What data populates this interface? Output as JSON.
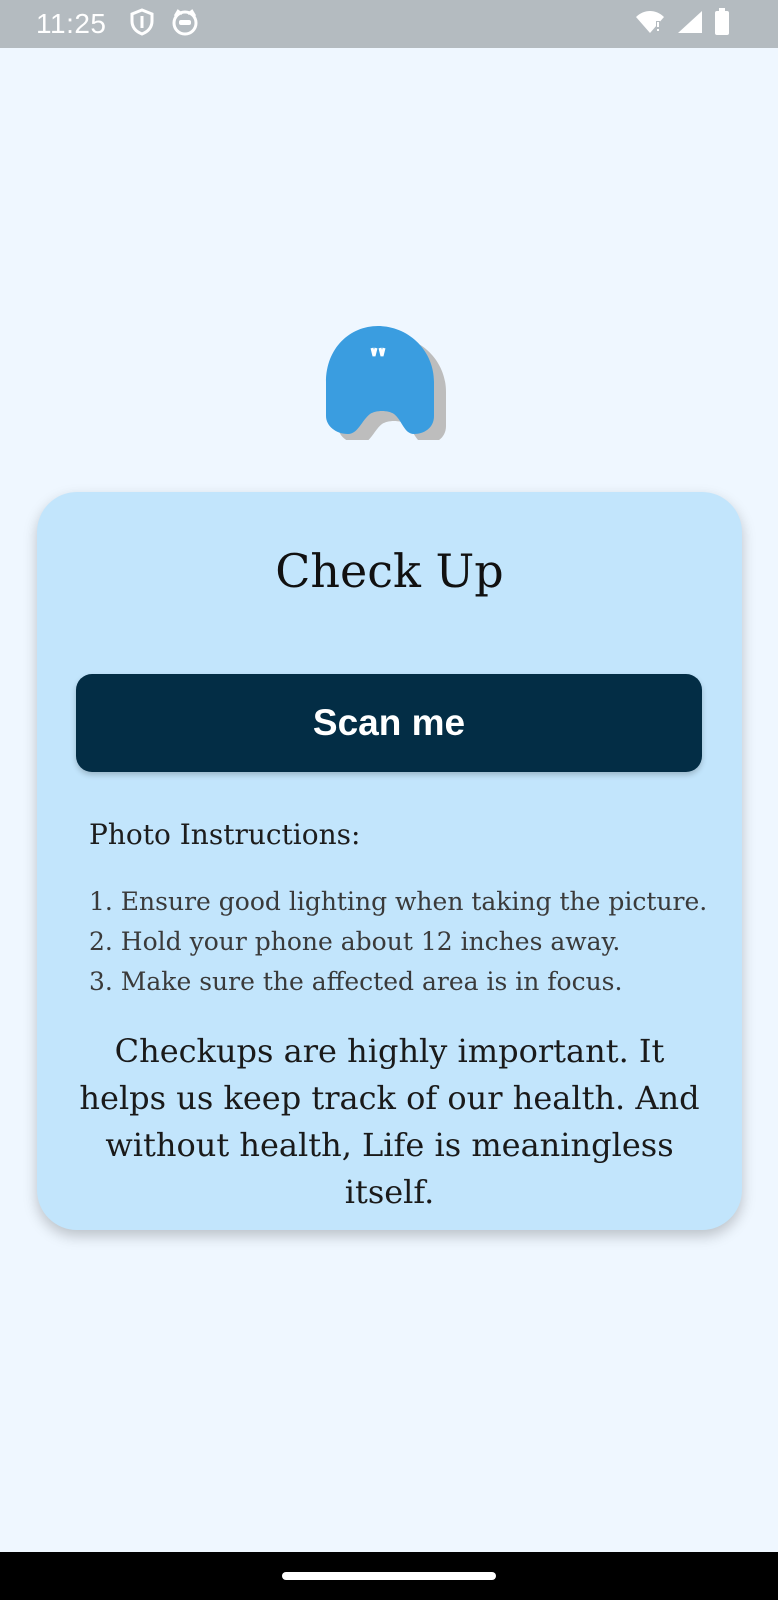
{
  "status_bar": {
    "time": "11:25",
    "left_icons": [
      "shield-icon",
      "cat-face-icon"
    ],
    "right_icons": [
      "wifi-alert-icon",
      "signal-icon",
      "battery-icon"
    ]
  },
  "logo": {
    "icon": "blue-tooth-logo-icon",
    "color": "#3a9de0"
  },
  "card": {
    "title": "Check Up",
    "button_label": "Scan me",
    "instructions_heading": "Photo Instructions:",
    "instructions": [
      "1. Ensure good lighting when taking the picture.",
      "2. Hold your phone about 12 inches away.",
      "3. Make sure the affected area is in focus."
    ],
    "message": "Checkups are highly important. It helps us keep track of our health. And without health, Life is meaningless itself."
  },
  "colors": {
    "background": "#eff7ff",
    "card": "#c2e5fc",
    "button": "#032d45",
    "status_bar": "#b4bbc0"
  }
}
